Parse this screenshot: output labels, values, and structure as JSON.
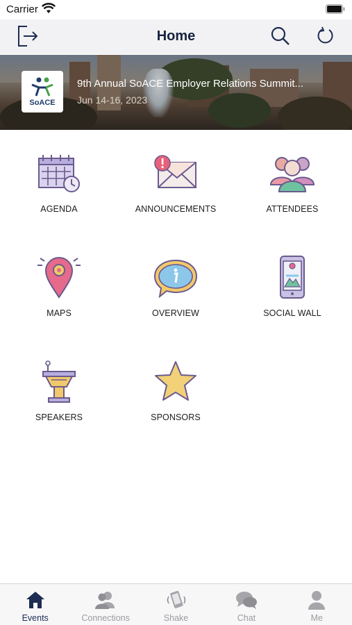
{
  "status_bar": {
    "carrier": "Carrier"
  },
  "nav": {
    "title": "Home",
    "icons": [
      "exit-icon",
      "search-icon",
      "refresh-icon"
    ]
  },
  "banner": {
    "title": "9th Annual SoACE Employer Relations Summit...",
    "date": "Jun 14-16, 2023",
    "logo_text": "SoACE"
  },
  "modules": [
    {
      "label": "AGENDA",
      "icon": "calendar-clock-icon"
    },
    {
      "label": "ANNOUNCEMENTS",
      "icon": "envelope-alert-icon"
    },
    {
      "label": "ATTENDEES",
      "icon": "people-group-icon"
    },
    {
      "label": "MAPS",
      "icon": "map-pin-icon"
    },
    {
      "label": "OVERVIEW",
      "icon": "info-bubble-icon"
    },
    {
      "label": "SOCIAL WALL",
      "icon": "phone-photo-icon"
    },
    {
      "label": "SPEAKERS",
      "icon": "podium-icon"
    },
    {
      "label": "SPONSORS",
      "icon": "star-icon"
    }
  ],
  "tabs": [
    {
      "label": "Events",
      "icon": "house-icon",
      "active": true
    },
    {
      "label": "Connections",
      "icon": "people-icon",
      "active": false
    },
    {
      "label": "Shake",
      "icon": "phone-shake-icon",
      "active": false
    },
    {
      "label": "Chat",
      "icon": "chat-bubbles-icon",
      "active": false
    },
    {
      "label": "Me",
      "icon": "person-icon",
      "active": false
    }
  ],
  "colors": {
    "nav_title": "#17233f",
    "active_tab": "#1d2c52",
    "inactive_tab": "#9b9ba0",
    "icon_outline": "#6b5a8e"
  }
}
